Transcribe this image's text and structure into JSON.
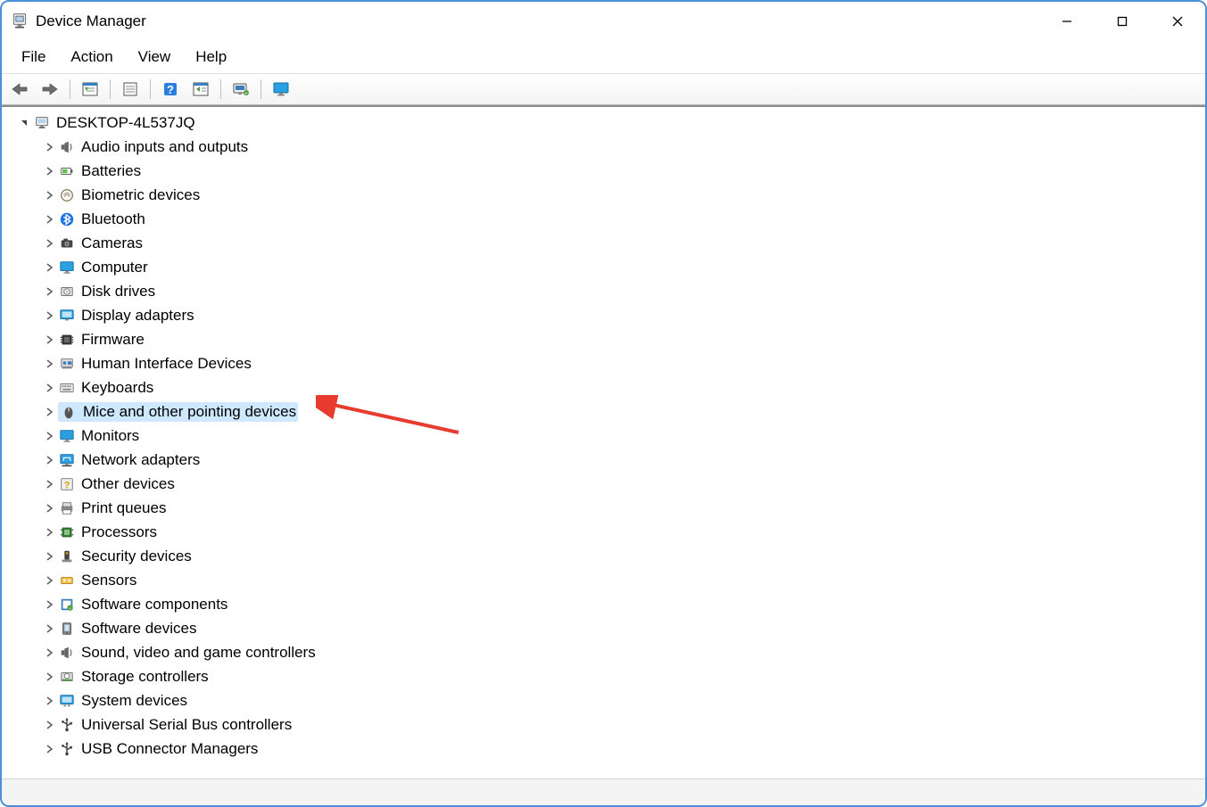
{
  "window": {
    "title": "Device Manager"
  },
  "menu": {
    "file": "File",
    "action": "Action",
    "view": "View",
    "help": "Help"
  },
  "toolbar": {
    "back": "back",
    "forward": "forward",
    "show_hidden": "show-hidden",
    "properties": "properties",
    "help": "help",
    "update": "update",
    "scan": "scan",
    "monitor": "monitor"
  },
  "tree": {
    "root": "DESKTOP-4L537JQ",
    "items": [
      {
        "label": "Audio inputs and outputs",
        "icon": "speaker"
      },
      {
        "label": "Batteries",
        "icon": "battery"
      },
      {
        "label": "Biometric devices",
        "icon": "fingerprint"
      },
      {
        "label": "Bluetooth",
        "icon": "bluetooth"
      },
      {
        "label": "Cameras",
        "icon": "camera"
      },
      {
        "label": "Computer",
        "icon": "monitor"
      },
      {
        "label": "Disk drives",
        "icon": "disk"
      },
      {
        "label": "Display adapters",
        "icon": "display"
      },
      {
        "label": "Firmware",
        "icon": "chip"
      },
      {
        "label": "Human Interface Devices",
        "icon": "hid"
      },
      {
        "label": "Keyboards",
        "icon": "keyboard"
      },
      {
        "label": "Mice and other pointing devices",
        "icon": "mouse",
        "selected": true
      },
      {
        "label": "Monitors",
        "icon": "monitor2"
      },
      {
        "label": "Network adapters",
        "icon": "network"
      },
      {
        "label": "Other devices",
        "icon": "other"
      },
      {
        "label": "Print queues",
        "icon": "printer"
      },
      {
        "label": "Processors",
        "icon": "cpu"
      },
      {
        "label": "Security devices",
        "icon": "security"
      },
      {
        "label": "Sensors",
        "icon": "sensor"
      },
      {
        "label": "Software components",
        "icon": "software"
      },
      {
        "label": "Software devices",
        "icon": "softdev"
      },
      {
        "label": "Sound, video and game controllers",
        "icon": "sound"
      },
      {
        "label": "Storage controllers",
        "icon": "storage"
      },
      {
        "label": "System devices",
        "icon": "system"
      },
      {
        "label": "Universal Serial Bus controllers",
        "icon": "usb"
      },
      {
        "label": "USB Connector Managers",
        "icon": "usbconn"
      }
    ]
  }
}
